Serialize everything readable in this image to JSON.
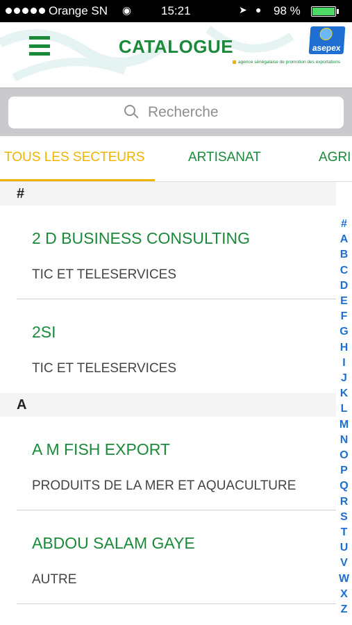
{
  "status_bar": {
    "carrier": "Orange SN",
    "time": "15:21",
    "battery_percent": "98 %",
    "battery_color": "#4cd964"
  },
  "header": {
    "title": "CATALOGUE",
    "logo_text": "asepex",
    "tagline": "agence sénégalaise de promotion des exportations",
    "menu_icon": "hamburger-menu-icon"
  },
  "search": {
    "placeholder": "Recherche",
    "icon": "search-icon"
  },
  "tabs": [
    {
      "label": "TOUS LES SECTEURS",
      "active": true
    },
    {
      "label": "ARTISANAT",
      "active": false
    },
    {
      "label": "AGRI",
      "active": false
    }
  ],
  "sections": [
    {
      "header": "#",
      "items": [
        {
          "name": "2 D BUSINESS CONSULTING",
          "sector": "TIC ET TELESERVICES"
        },
        {
          "name": "2SI",
          "sector": "TIC ET TELESERVICES"
        }
      ]
    },
    {
      "header": "A",
      "items": [
        {
          "name": "A M FISH EXPORT",
          "sector": "PRODUITS DE LA MER ET AQUACULTURE"
        },
        {
          "name": "ABDOU SALAM GAYE",
          "sector": "AUTRE"
        }
      ]
    }
  ],
  "alpha_index": [
    "#",
    "A",
    "B",
    "C",
    "D",
    "E",
    "F",
    "G",
    "H",
    "I",
    "J",
    "K",
    "L",
    "M",
    "N",
    "O",
    "P",
    "Q",
    "R",
    "S",
    "T",
    "U",
    "V",
    "W",
    "X",
    "Z"
  ],
  "colors": {
    "brand_green": "#1a8a3a",
    "accent_yellow": "#f0b400",
    "index_blue": "#1e6fd1"
  }
}
